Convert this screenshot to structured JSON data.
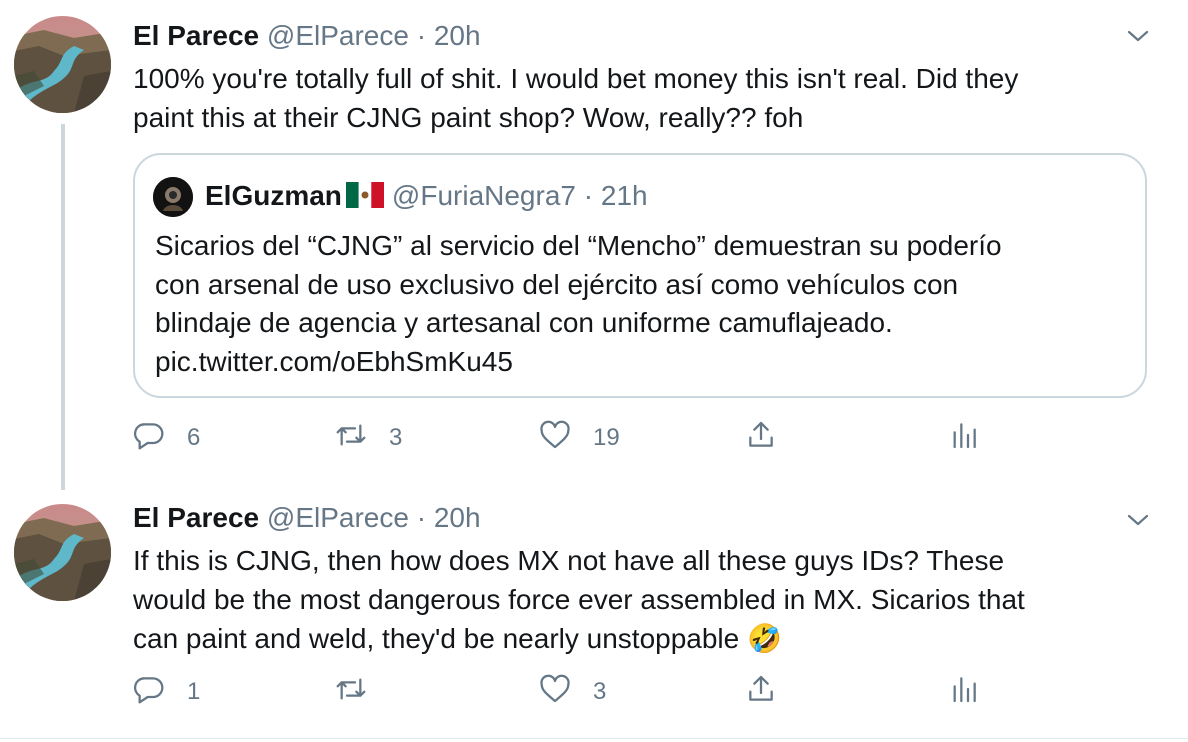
{
  "tweets": [
    {
      "display_name": "El Parece",
      "handle": "@ElParece",
      "separator": "·",
      "time": "20h",
      "text": "100% you're totally full of shit. I would bet money this isn't real. Did they\npaint this at their CJNG paint shop? Wow, really?? foh",
      "quote": {
        "display_name": "ElGuzman",
        "flag_icon": "mexico-flag-icon",
        "handle": "@FuriaNegra7",
        "separator": "·",
        "time": "21h",
        "text": "Sicarios del “CJNG” al servicio del “Mencho” demuestran su poderío\ncon arsenal de uso exclusivo del ejército así como vehículos con\nblindaje de agencia y artesanal con uniforme camuflajeado.\npic.twitter.com/oEbhSmKu45"
      },
      "actions": {
        "replies": "6",
        "retweets": "3",
        "likes": "19"
      }
    },
    {
      "display_name": "El Parece",
      "handle": "@ElParece",
      "separator": "·",
      "time": "20h",
      "text": "If this is CJNG, then how does MX not have all these guys IDs? These\nwould be the most dangerous force ever assembled in MX. Sicarios that\ncan paint and weld, they'd be nearly unstoppable 🤣",
      "actions": {
        "replies": "1",
        "retweets": "",
        "likes": "3"
      }
    }
  ],
  "colors": {
    "text": "#14171a",
    "secondary": "#657786",
    "border": "#ccd6dd",
    "thread": "#ccd6dd"
  }
}
